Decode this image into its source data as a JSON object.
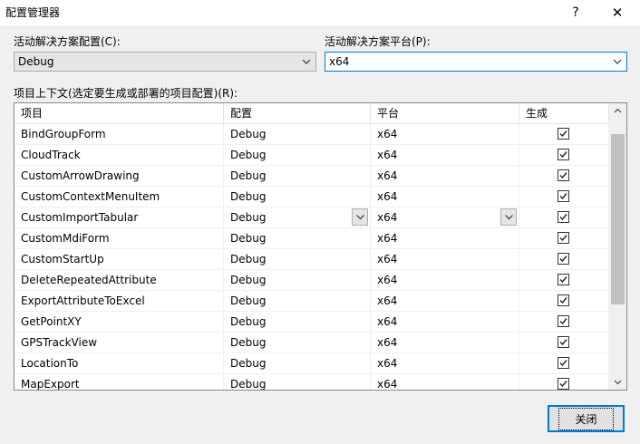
{
  "window": {
    "title": "配置管理器",
    "help": "?",
    "close": "✕"
  },
  "active_config": {
    "label": "活动解决方案配置(C):",
    "value": "Debug"
  },
  "active_platform": {
    "label": "活动解决方案平台(P):",
    "value": "x64"
  },
  "grid_label": "项目上下文(选定要生成或部署的项目配置)(R):",
  "columns": [
    "项目",
    "配置",
    "平台",
    "生成"
  ],
  "rows": [
    {
      "project": "BindGroupForm",
      "config": "Debug",
      "platform": "x64",
      "build": true
    },
    {
      "project": "CloudTrack",
      "config": "Debug",
      "platform": "x64",
      "build": true
    },
    {
      "project": "CustomArrowDrawing",
      "config": "Debug",
      "platform": "x64",
      "build": true
    },
    {
      "project": "CustomContextMenuItem",
      "config": "Debug",
      "platform": "x64",
      "build": true
    },
    {
      "project": "CustomImportTabular",
      "config": "Debug",
      "platform": "x64",
      "build": true
    },
    {
      "project": "CustomMdiForm",
      "config": "Debug",
      "platform": "x64",
      "build": true
    },
    {
      "project": "CustomStartUp",
      "config": "Debug",
      "platform": "x64",
      "build": true
    },
    {
      "project": "DeleteRepeatedAttribute",
      "config": "Debug",
      "platform": "x64",
      "build": true
    },
    {
      "project": "ExportAttributeToExcel",
      "config": "Debug",
      "platform": "x64",
      "build": true
    },
    {
      "project": "GetPointXY",
      "config": "Debug",
      "platform": "x64",
      "build": true
    },
    {
      "project": "GPSTrackView",
      "config": "Debug",
      "platform": "x64",
      "build": true
    },
    {
      "project": "LocationTo",
      "config": "Debug",
      "platform": "x64",
      "build": true
    },
    {
      "project": "MapExport",
      "config": "Debug",
      "platform": "x64",
      "build": true
    }
  ],
  "close_button": "关闭",
  "colors": {
    "accent": "#0078d7"
  }
}
